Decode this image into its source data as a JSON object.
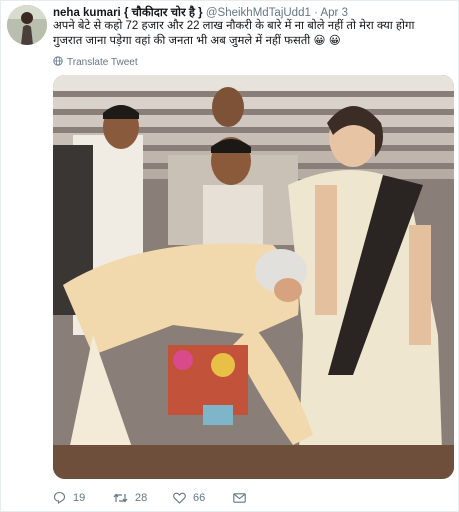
{
  "tweet": {
    "author_name": "neha kumari",
    "author_tag": "{ चौकीदार चोर है }",
    "handle": "@SheikhMdTajUdd1",
    "separator": "·",
    "date": "Apr 3",
    "text_line1": "अपने बेटे से कहो 72 हजार और 22 लाख  नौकरी के बारे में ना बोले नहीं तो मेरा क्या होगा",
    "text_line2": "गुजरात जाना पड़ेगा वहां की जनता भी अब जुमले में नहीं फसती",
    "emojis": [
      "😀",
      "😀"
    ],
    "translate_label": "Translate Tweet"
  },
  "actions": {
    "reply_count": "19",
    "retweet_count": "28",
    "like_count": "66"
  },
  "icons": {
    "avatar": "user-avatar",
    "translate": "globe-icon",
    "reply": "reply-icon",
    "retweet": "retweet-icon",
    "like": "heart-icon",
    "dm": "envelope-icon"
  },
  "colors": {
    "name": "#14171a",
    "secondary": "#657786",
    "emoji": "#f4c430"
  }
}
